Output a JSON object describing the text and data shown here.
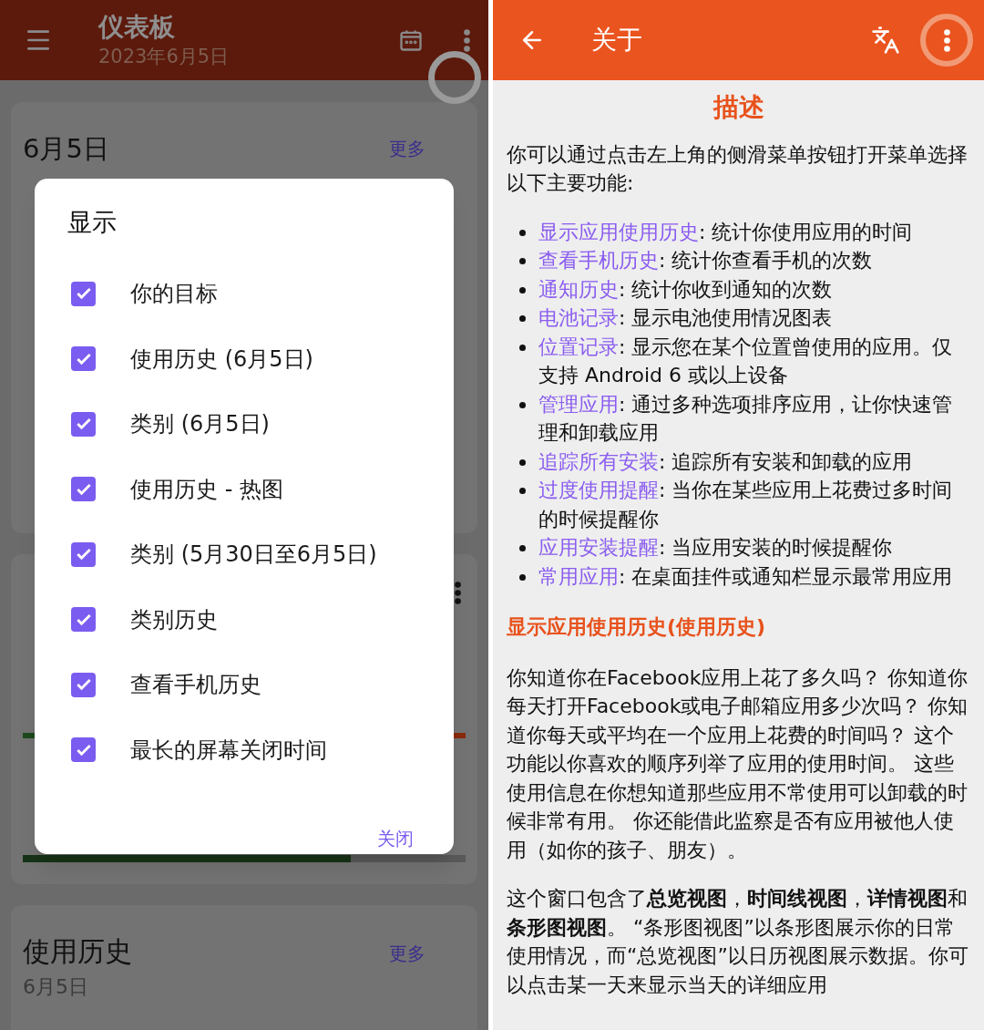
{
  "dashboard": {
    "title": "仪表板",
    "subtitle": "2023年6月5日",
    "cards": [
      {
        "kind": "date",
        "title": "6月5日",
        "more": "更多"
      },
      {
        "kind": "bars",
        "bars": [
          {
            "level": 0.74
          }
        ]
      },
      {
        "kind": "history",
        "title": "使用历史",
        "subtitle": "6月5日",
        "more": "更多"
      }
    ]
  },
  "dialog": {
    "title": "显示",
    "items": [
      {
        "label": "你的目标",
        "checked": true
      },
      {
        "label": "使用历史 (6月5日)",
        "checked": true
      },
      {
        "label": "类别 (6月5日)",
        "checked": true
      },
      {
        "label": "使用历史 - 热图",
        "checked": true
      },
      {
        "label": "类别 (5月30日至6月5日)",
        "checked": true
      },
      {
        "label": "类别历史",
        "checked": true
      },
      {
        "label": "查看手机历史",
        "checked": true
      },
      {
        "label": "最长的屏幕关闭时间",
        "checked": true
      }
    ],
    "button": "关闭"
  },
  "about": {
    "title": "关于",
    "heading": "描述",
    "intro": "你可以通过点击左上角的侧滑菜单按钮打开菜单选择以下主要功能:",
    "features": [
      {
        "link": "显示应用使用历史",
        "text": ": 统计你使用应用的时间"
      },
      {
        "link": "查看手机历史",
        "text": ": 统计你查看手机的次数"
      },
      {
        "link": "通知历史",
        "text": ": 统计你收到通知的次数"
      },
      {
        "link": "电池记录",
        "text": ": 显示电池使用情况图表"
      },
      {
        "link": "位置记录",
        "text": ": 显示您在某个位置曾使用的应用。仅支持 Android 6 或以上设备"
      },
      {
        "link": "管理应用",
        "text": ": 通过多种选项排序应用，让你快速管理和卸载应用"
      },
      {
        "link": "追踪所有安装",
        "text": ": 追踪所有安装和卸载的应用"
      },
      {
        "link": "过度使用提醒",
        "text": ": 当你在某些应用上花费过多时间的时候提醒你"
      },
      {
        "link": "应用安装提醒",
        "text": ": 当应用安装的时候提醒你"
      },
      {
        "link": "常用应用",
        "text": ": 在桌面挂件或通知栏显示最常用应用"
      }
    ],
    "section": "显示应用使用历史(使用历史)",
    "paragraphs": [
      "你知道你在Facebook应用上花了多久吗？ 你知道你每天打开Facebook或电子邮箱应用多少次吗？ 你知道你每天或平均在一个应用上花费的时间吗？ 这个功能以你喜欢的顺序列举了应用的使用时间。 这些使用信息在你想知道那些应用不常使用可以卸载的时候非常有用。 你还能借此监察是否有应用被他人使用（如你的孩子、朋友）。",
      "这个窗口包含了**总览视图**，**时间线视图**，**详情视图**和**条形图视图**。 “条形图视图”以条形图展示你的日常使用情况，而“总览视图”以日历视图展示数据。你可以点击某一天来显示当天的详细应用"
    ]
  }
}
